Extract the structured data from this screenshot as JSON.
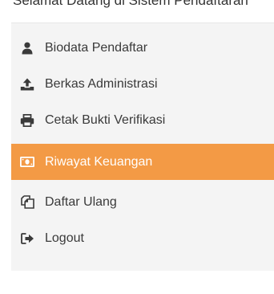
{
  "header": {
    "partial_text": "Selamat Datang di Sistem Pendaftaran"
  },
  "sidebar": {
    "items": [
      {
        "label": "Biodata Pendaftar",
        "icon": "user-icon",
        "active": false
      },
      {
        "label": "Berkas Administrasi",
        "icon": "upload-icon",
        "active": false
      },
      {
        "label": "Cetak Bukti Verifikasi",
        "icon": "print-icon",
        "active": false
      },
      {
        "label": "Riwayat Keuangan",
        "icon": "money-icon",
        "active": true
      },
      {
        "label": "Daftar Ulang",
        "icon": "copy-icon",
        "active": false
      },
      {
        "label": "Logout",
        "icon": "sign-out-icon",
        "active": false
      }
    ],
    "colors": {
      "active_bg": "#f39a45",
      "panel_bg": "#f4f4f4",
      "text": "#3a3a3a"
    }
  }
}
